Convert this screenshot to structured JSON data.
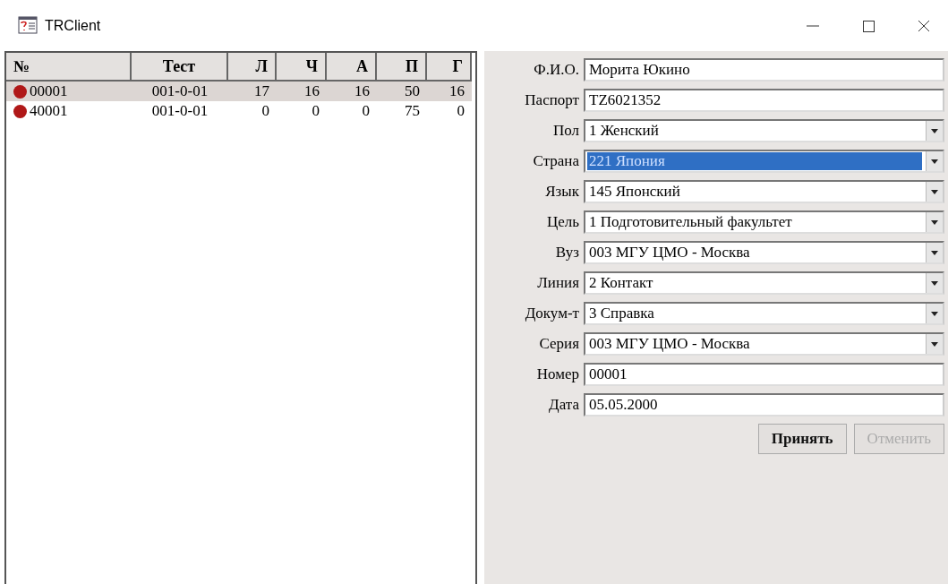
{
  "window": {
    "title": "TRClient"
  },
  "table": {
    "columns": [
      "№",
      "Тест",
      "Л",
      "Ч",
      "А",
      "П",
      "Г"
    ],
    "rows": [
      {
        "selected": true,
        "color": "#b01818",
        "cells": [
          "00001",
          "001-0-01",
          "17",
          "16",
          "16",
          "50",
          "16"
        ]
      },
      {
        "selected": false,
        "color": "#b01818",
        "cells": [
          "40001",
          "001-0-01",
          "0",
          "0",
          "0",
          "75",
          "0"
        ]
      }
    ]
  },
  "form": {
    "fields": [
      {
        "kind": "text",
        "label": "Ф.И.О.",
        "value": "Морита Юкино",
        "selected": false
      },
      {
        "kind": "text",
        "label": "Паспорт",
        "value": "TZ6021352",
        "selected": false
      },
      {
        "kind": "select",
        "label": "Пол",
        "value": "1 Женский",
        "selected": false
      },
      {
        "kind": "select",
        "label": "Страна",
        "value": "221 Япония",
        "selected": true
      },
      {
        "kind": "select",
        "label": "Язык",
        "value": "145 Японский",
        "selected": false
      },
      {
        "kind": "select",
        "label": "Цель",
        "value": "1 Подготовительный факультет",
        "selected": false
      },
      {
        "kind": "select",
        "label": "Вуз",
        "value": "003 МГУ ЦМО - Москва",
        "selected": false
      },
      {
        "kind": "select",
        "label": "Линия",
        "value": "2 Контакт",
        "selected": false
      },
      {
        "kind": "select",
        "label": "Докум-т",
        "value": "3 Справка",
        "selected": false
      },
      {
        "kind": "select",
        "label": "Серия",
        "value": "003 МГУ ЦМО - Москва",
        "selected": false
      },
      {
        "kind": "text",
        "label": "Номер",
        "value": "00001",
        "selected": false
      },
      {
        "kind": "text",
        "label": "Дата",
        "value": "05.05.2000",
        "selected": false
      }
    ],
    "buttons": [
      {
        "label": "Принять",
        "disabled": false
      },
      {
        "label": "Отменить",
        "disabled": true
      }
    ]
  }
}
